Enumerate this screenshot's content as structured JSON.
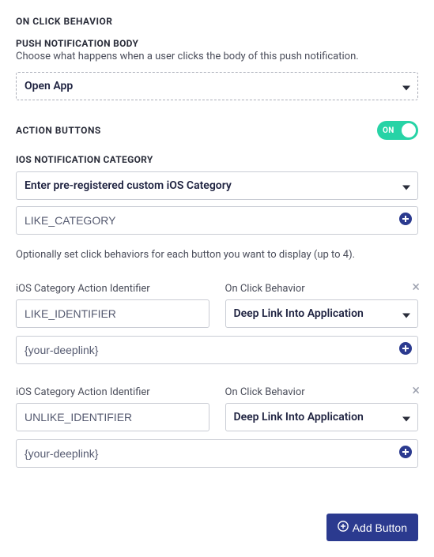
{
  "onClickBehavior": {
    "title": "ON CLICK BEHAVIOR"
  },
  "pushBody": {
    "title": "PUSH NOTIFICATION BODY",
    "description": "Choose what happens when a user clicks the body of this push notification.",
    "selected": "Open App"
  },
  "actionButtons": {
    "title": "ACTION BUTTONS",
    "toggleState": "ON"
  },
  "iosCategory": {
    "title": "IOS NOTIFICATION CATEGORY",
    "selected": "Enter pre-registered custom iOS Category",
    "inputValue": "LIKE_CATEGORY"
  },
  "optionalNote": "Optionally set click behaviors for each button you want to display (up to 4).",
  "fieldLabels": {
    "identifier": "iOS Category Action Identifier",
    "onClick": "On Click Behavior"
  },
  "buttons": [
    {
      "identifier": "LIKE_IDENTIFIER",
      "onClickSelected": "Deep Link Into Application",
      "deeplink": "{your-deeplink}"
    },
    {
      "identifier": "UNLIKE_IDENTIFIER",
      "onClickSelected": "Deep Link Into Application",
      "deeplink": "{your-deeplink}"
    }
  ],
  "addButtonLabel": "Add Button"
}
